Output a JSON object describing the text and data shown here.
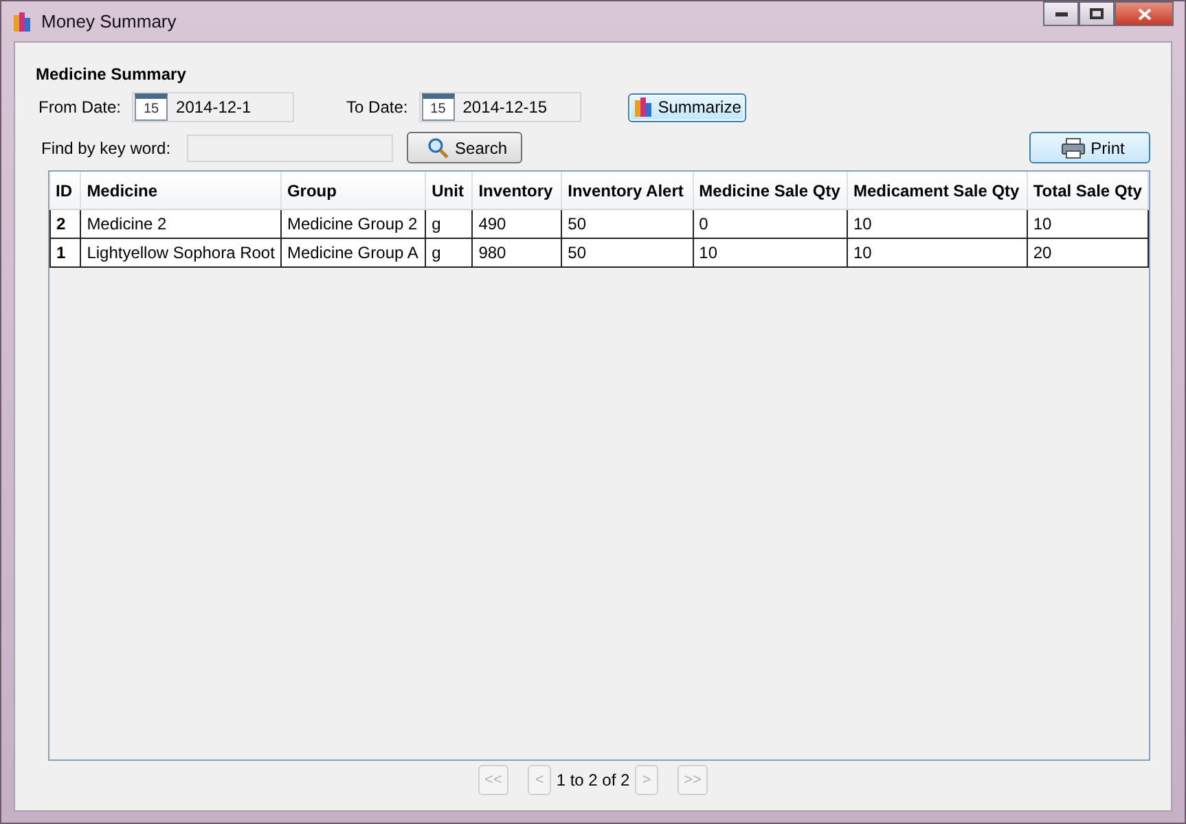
{
  "window": {
    "title": "Money Summary"
  },
  "section_title": "Medicine Summary",
  "from_date": {
    "label": "From Date:",
    "value": "2014-12-1",
    "icon_text": "15"
  },
  "to_date": {
    "label": "To Date:",
    "value": "2014-12-15",
    "icon_text": "15"
  },
  "summarize_button": {
    "label": "Summarize",
    "focused": true
  },
  "keyword": {
    "label": "Find by key word:"
  },
  "search_button": {
    "label": "Search"
  },
  "print_button": {
    "label": "Print"
  },
  "table": {
    "columns": [
      "ID",
      "Medicine",
      "Group",
      "Unit",
      "Inventory",
      "Inventory Alert",
      "Medicine Sale Qty",
      "Medicament Sale Qty",
      "Total Sale Qty"
    ],
    "rows": [
      [
        "2",
        "Medicine 2",
        "Medicine Group 2",
        "g",
        "490",
        "50",
        "0",
        "10",
        "10"
      ],
      [
        "1",
        "Lightyellow Sophora Root",
        "Medicine Group A",
        "g",
        "980",
        "50",
        "10",
        "10",
        "20"
      ]
    ]
  },
  "pager": {
    "first": {
      "label": "<<",
      "disabled": true
    },
    "prev": {
      "label": "<",
      "disabled": true
    },
    "status": "1 to 2 of 2",
    "next": {
      "label": ">",
      "disabled": true
    },
    "last": {
      "label": ">>",
      "disabled": true
    }
  }
}
